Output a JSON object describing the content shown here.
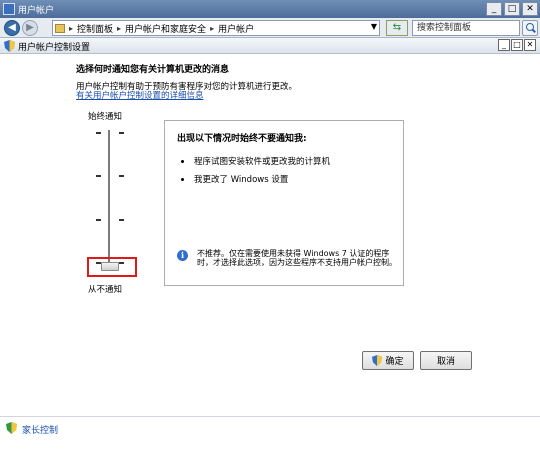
{
  "window": {
    "title": "用户帐户",
    "minimize": "_",
    "maximize": "□",
    "close": "✕"
  },
  "address_bar": {
    "back": "◀",
    "forward": "▶",
    "breadcrumbs": [
      "控制面板",
      "用户帐户和家庭安全",
      "用户帐户"
    ],
    "separator": "▸",
    "search_placeholder": "搜索控制面板"
  },
  "dialog": {
    "title": "用户帐户控制设置",
    "minimize": "_",
    "maximize": "□",
    "close": "✕"
  },
  "main": {
    "heading": "选择何时通知您有关计算机更改的消息",
    "description": "用户帐户控制有助于预防有害程序对您的计算机进行更改。",
    "link": "有关用户帐户控制设置的详细信息"
  },
  "slider": {
    "top_label": "始终通知",
    "bottom_label": "从不通知",
    "levels": 4,
    "selected_level": 1
  },
  "info_panel": {
    "heading": "出现以下情况时始终不要通知我:",
    "bullets": [
      "程序试图安装软件或更改我的计算机",
      "我更改了 Windows 设置"
    ],
    "note": "不推荐。仅在需要使用未获得 Windows 7 认证的程序时，才选择此选项，因为这些程序不支持用户帐户控制。"
  },
  "buttons": {
    "ok": "确定",
    "cancel": "取消"
  },
  "footer": {
    "parental_controls": "家长控制"
  },
  "colors": {
    "highlight": "#e01a1a",
    "link": "#1a4fb0",
    "title_bar": "#4d6c9a"
  }
}
